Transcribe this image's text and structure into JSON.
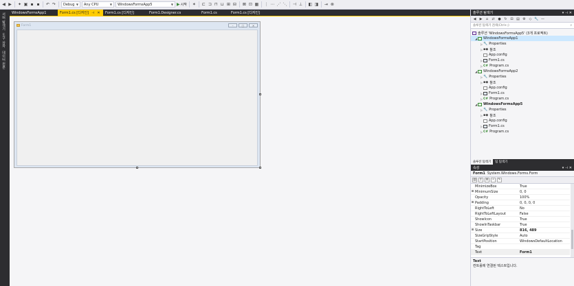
{
  "toolbar": {
    "config": "Debug",
    "platform": "Any CPU",
    "startup_project": "WindowsFormsApp5",
    "start_label": "시작"
  },
  "left_strip": {
    "tabs": [
      "서버 탐색기",
      "도구 상자",
      "데이터 원본"
    ]
  },
  "doc_tabs": [
    {
      "label": "WindowsFormsApp1"
    },
    {
      "label": "Form1.cs [디자인]"
    },
    {
      "label": "Form1.cs [디자인]"
    },
    {
      "label": "Form1.Designer.cs"
    },
    {
      "label": "Form1.cs"
    },
    {
      "label": "Form1.cs [디자인]"
    }
  ],
  "form_designer": {
    "title": "Form1"
  },
  "solution_explorer": {
    "title": "솔루션 탐색기",
    "search_placeholder": "솔루션 탐색기 검색(Ctrl+;)",
    "items": [
      {
        "label": "솔루션 'WindowsFormsApp5' (3개 프로젝트)"
      },
      {
        "label": "WindowsFormsApp1"
      },
      {
        "label": "Properties"
      },
      {
        "label": "참조"
      },
      {
        "label": "App.config"
      },
      {
        "label": "Form1.cs"
      },
      {
        "label": "Program.cs"
      },
      {
        "label": "WindowsFormsApp2"
      },
      {
        "label": "Properties"
      },
      {
        "label": "참조"
      },
      {
        "label": "App.config"
      },
      {
        "label": "Form1.cs"
      },
      {
        "label": "Program.cs"
      },
      {
        "label": "WindowsFormsApp5"
      },
      {
        "label": "Properties"
      },
      {
        "label": "참조"
      },
      {
        "label": "App.config"
      },
      {
        "label": "Form1.cs"
      },
      {
        "label": "Program.cs"
      }
    ],
    "tabs": [
      "솔루션 탐색기",
      "팀 탐색기"
    ]
  },
  "properties": {
    "title": "속성",
    "object_name": "Form1",
    "object_type": "System.Windows.Forms.Form",
    "rows": [
      {
        "name": "MinimizeBox",
        "value": "True"
      },
      {
        "name": "MinimumSize",
        "value": "0, 0"
      },
      {
        "name": "Opacity",
        "value": "100%"
      },
      {
        "name": "Padding",
        "value": "0, 0, 0, 0"
      },
      {
        "name": "RightToLeft",
        "value": "No"
      },
      {
        "name": "RightToLeftLayout",
        "value": "False"
      },
      {
        "name": "ShowIcon",
        "value": "True"
      },
      {
        "name": "ShowInTaskbar",
        "value": "True"
      },
      {
        "name": "Size",
        "value": "816, 489"
      },
      {
        "name": "SizeGripStyle",
        "value": "Auto"
      },
      {
        "name": "StartPosition",
        "value": "WindowsDefaultLocation"
      },
      {
        "name": "Tag",
        "value": ""
      },
      {
        "name": "Text",
        "value": "Form1"
      }
    ],
    "description_title": "Text",
    "description_text": "컨트롤에 연결된 텍스트입니다."
  }
}
